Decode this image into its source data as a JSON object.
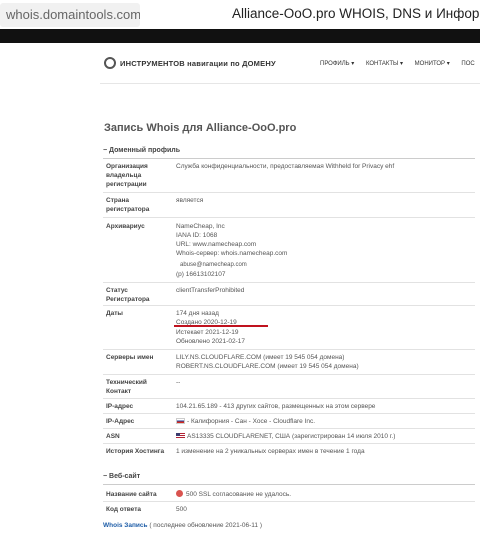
{
  "browser": {
    "address": "whois.domaintools.com",
    "tab_title": "Alliance-OoO.pro WHOIS, DNS и Информац"
  },
  "nav": {
    "logo_text": "ИНСТРУМЕНТОВ навигации по ДОМЕНУ",
    "links": [
      "ПРОФИЛЬ ▾",
      "КОНТАКТЫ ▾",
      "МОНИТОР ▾",
      "ПОС"
    ]
  },
  "page": {
    "heading": "Запись Whois для Alliance-OoO.pro",
    "section_domain": "− Доменный профиль",
    "section_web": "− Веб-сайт",
    "rows": {
      "org_label": "Организация владельца регистрации",
      "org_value": "Служба конфиденциальности, предоставляемая Withheld for Privacy ehf",
      "country_label": "Страна регистратора",
      "country_value": "является",
      "registrar_label": "Архивариус",
      "registrar_lines": [
        "NameCheap, Inc",
        "IANA ID: 1068",
        "URL: www.namecheap.com",
        "Whois-сервер: whois.namecheap.com",
        "abuse@namecheap.com",
        "(p) 16613102107"
      ],
      "status_label": "Статус Регистратора",
      "status_value": "clientTransferProhibited",
      "dates_label": "Даты",
      "dates_lines": [
        "174 дня назад",
        "Создано 2020-12-19",
        "Истекает 2021-12-19",
        "Обновлено 2021-02-17"
      ],
      "ns_label": "Серверы имен",
      "ns_lines": [
        "LILY.NS.CLOUDFLARE.COM (имеет 19 545 054 домена)",
        "ROBERT.NS.CLOUDFLARE.COM (имеет 19 545 054 домена)"
      ],
      "tech_label": "Технический Контакт",
      "tech_value": "--",
      "ip_label": "IP-адрес",
      "ip_value": "104.21.65.189 - 413 других сайтов, размещенных на этом сервере",
      "ipaddr_label": "IP-Адрес",
      "ipaddr_value": "- Калифорния - Сан - Хосе - Cloudflare Inc.",
      "asn_label": "ASN",
      "asn_value": "AS13335 CLOUDFLARENET, США (зарегистрирован 14 июля 2010 г.)",
      "history_label": "История Хостинга",
      "history_value": "1 изменение на 2 уникальных серверах имен в течение 1 года",
      "site_label": "Название сайта",
      "site_value": "500 SSL согласование не удалось.",
      "code_label": "Код ответа",
      "code_value": "500"
    },
    "footer_bold": "Whois Запись",
    "footer_rest": " ( последнее обновление 2021-06-11 )"
  },
  "colors": {
    "accent_red": "#c0121e",
    "link_blue": "#1f5ea8"
  }
}
